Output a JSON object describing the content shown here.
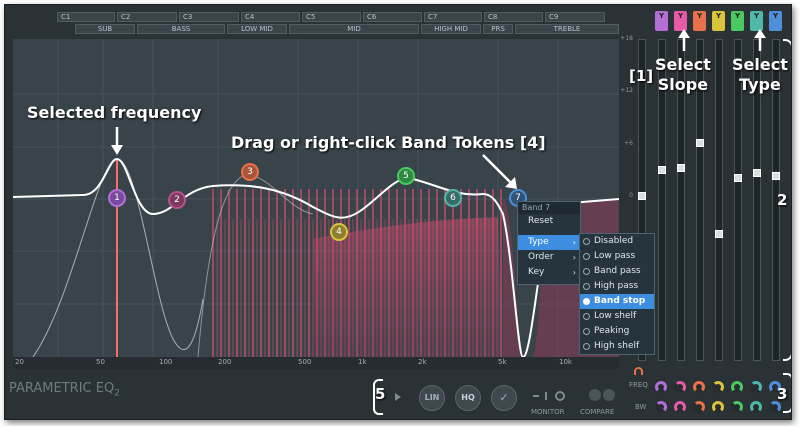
{
  "window": {
    "logo_main": "PARAMETRIC EQ",
    "logo_sub": "2"
  },
  "notes_row": [
    "C1",
    "C2",
    "C3",
    "C4",
    "C5",
    "C6",
    "C7",
    "C8",
    "C9"
  ],
  "bands_row": [
    "SUB",
    "BASS",
    "LOW MID",
    "MID",
    "HIGH MID",
    "PRS",
    "TREBLE"
  ],
  "freq_scale": [
    "20",
    "50",
    "100",
    "200",
    "500",
    "1k",
    "2k",
    "5k",
    "10k"
  ],
  "db_scale": [
    "+18",
    "+12",
    "+6",
    "0",
    "-6",
    "-12",
    "-18"
  ],
  "tokens": [
    {
      "label": "1",
      "color": "#b36fd6"
    },
    {
      "label": "2",
      "color": "#c04e8e"
    },
    {
      "label": "3",
      "color": "#e8704a"
    },
    {
      "label": "4",
      "color": "#d9c53a"
    },
    {
      "label": "5",
      "color": "#49c960"
    },
    {
      "label": "6",
      "color": "#4fb8a8"
    },
    {
      "label": "7",
      "color": "#4f8fd8"
    }
  ],
  "callouts": {
    "selected_frequency": "Selected frequency",
    "drag_tokens": "Drag or right-click Band Tokens [4]",
    "one": "[1]",
    "select_slope": "Select\nSlope",
    "select_type": "Select\nType",
    "two": "2",
    "three": "3",
    "five": "5"
  },
  "context_menu": {
    "header": "Band 7",
    "items": [
      {
        "label": "Reset",
        "submenu": false
      },
      {
        "label": "Type",
        "submenu": true
      },
      {
        "label": "Order",
        "submenu": true
      },
      {
        "label": "Key",
        "submenu": true
      }
    ]
  },
  "type_submenu": {
    "items": [
      "Disabled",
      "Low pass",
      "Band pass",
      "High pass",
      "Band stop",
      "Low shelf",
      "Peaking",
      "High shelf"
    ],
    "selected": "Band stop"
  },
  "bottom_controls": {
    "lin_label": "LIN",
    "hq_label": "HQ",
    "monitor_label": "MONITOR",
    "compare_label": "COMPARE"
  },
  "side_labels": {
    "freq": "FREQ",
    "bw": "BW"
  },
  "colors": {
    "band1": "#b36fd6",
    "band2": "#e85aa8",
    "band3": "#e8704a",
    "band4": "#d9c53a",
    "band5": "#49c960",
    "band6": "#4fb8a8",
    "band7": "#4f8fd8",
    "selected_line": "#ff6b6b",
    "menu_highlight": "#3d8ee0"
  }
}
